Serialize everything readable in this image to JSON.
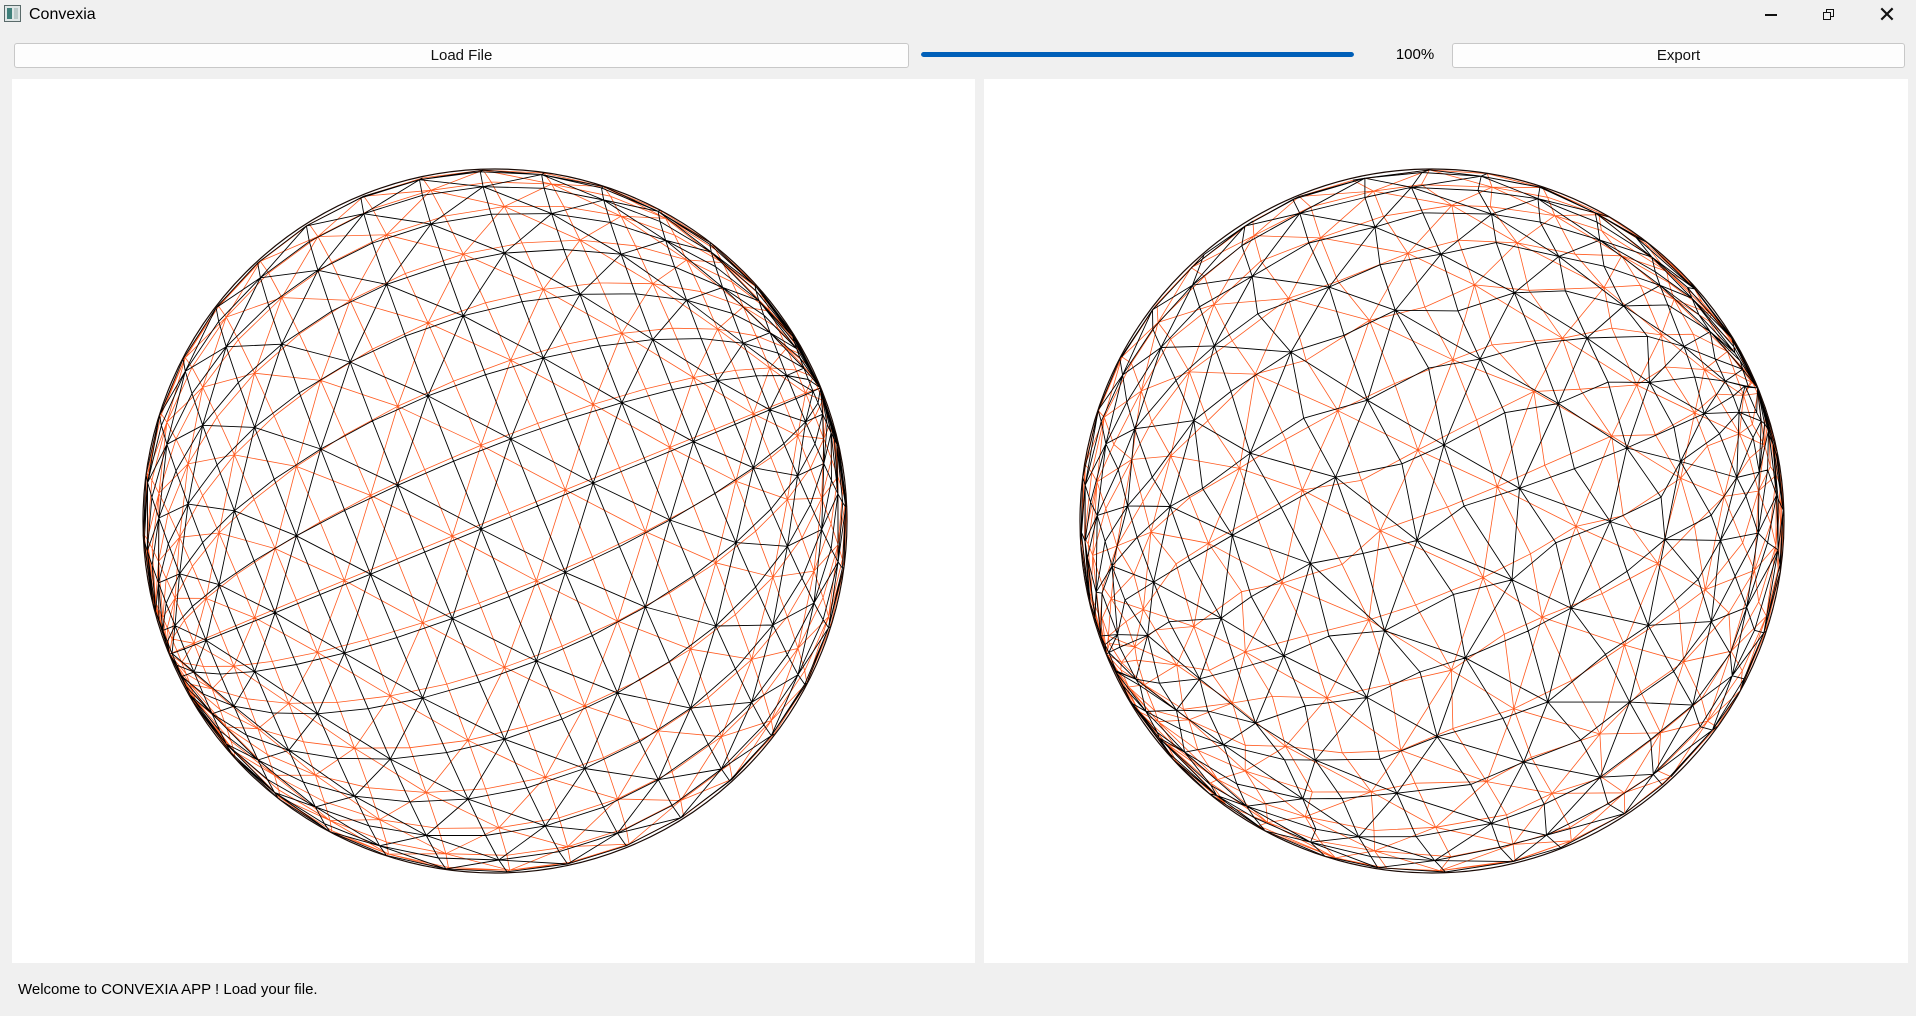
{
  "window": {
    "title": "Convexia",
    "icon": "app-icon",
    "controls": [
      "minimize-icon",
      "restore-icon",
      "close-icon"
    ]
  },
  "toolbar": {
    "load_label": "Load File",
    "export_label": "Export",
    "progress_text": "100%",
    "progress_value": 1.0,
    "progress_color": "#005fb8"
  },
  "viewports": {
    "left": {
      "content": "wireframe-sphere",
      "front_color": "#000000",
      "back_color": "#ff5a1f"
    },
    "right": {
      "content": "wireframe-sphere",
      "front_color": "#000000",
      "back_color": "#ff5a1f"
    }
  },
  "status": {
    "message": "Welcome to CONVEXIA APP ! Load your file."
  }
}
